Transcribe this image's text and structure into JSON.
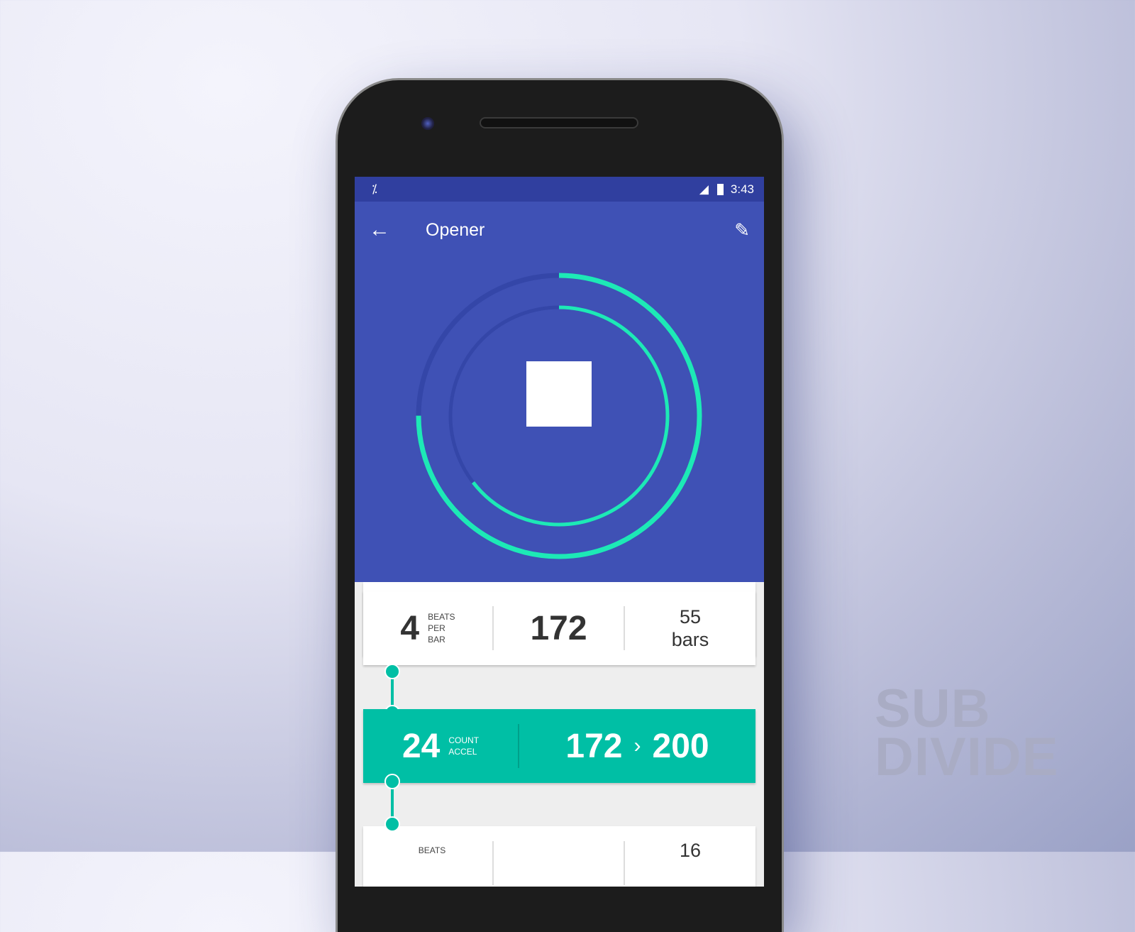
{
  "status_bar": {
    "app_icon": "subdivide-logo-icon",
    "signal_icon": "signal-icon",
    "battery_icon": "battery-icon",
    "time": "3:43"
  },
  "app_bar": {
    "title": "Opener",
    "back_icon": "arrow-back-icon",
    "edit_icon": "pencil-icon"
  },
  "player": {
    "outer_progress": 0.75,
    "inner_progress": 0.645,
    "stop_icon": "stop-icon",
    "accent": "#1de9b6",
    "track": "#3446a8"
  },
  "sections": [
    {
      "beats": "4",
      "beats_label": [
        "BEATS",
        "PER",
        "BAR"
      ],
      "tempo": "172",
      "bars_count": "55",
      "bars_label": "bars"
    },
    {
      "count": "24",
      "count_label": [
        "COUNT",
        "ACCEL"
      ],
      "tempo_from": "172",
      "tempo_to": "200",
      "arrow": "›"
    },
    {
      "beats_label": [
        "BEATS"
      ],
      "bars_count": "16"
    }
  ],
  "watermark": [
    "SUB",
    "DIVIDE"
  ]
}
